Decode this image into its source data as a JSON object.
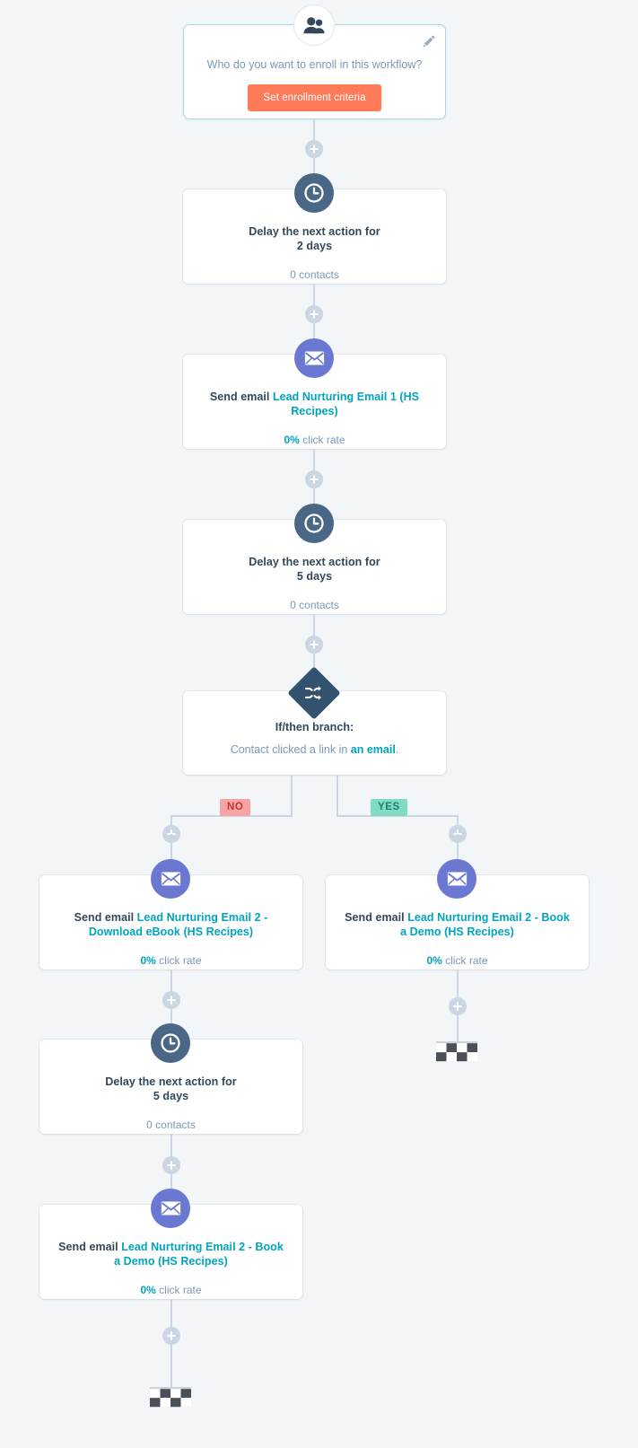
{
  "colors": {
    "background": "#f2f6f9",
    "card": "#ffffff",
    "connector": "#cbd6e2",
    "title_text": "#33475b",
    "muted_text": "#7c98b6",
    "link": "#00a4bd",
    "cta_button": "#ff7a59",
    "delay_icon": "#4a6785",
    "email_icon": "#6a78d1",
    "branch_icon": "#33526e",
    "badge_no_bg": "#f8a3a4",
    "badge_no_text": "#c0373a",
    "badge_yes_bg": "#7fdbc4",
    "badge_yes_text": "#1b8273",
    "enroll_border": "#a8d7e0"
  },
  "enrollment": {
    "icon": "contacts-icon",
    "question": "Who do you want to enroll in this workflow?",
    "button_label": "Set enrollment criteria",
    "edit_icon": "pencil-icon"
  },
  "nodes": [
    {
      "id": "delay-1",
      "icon": "clock-icon",
      "title_prefix": "Delay the next action for",
      "title_value": "2 days",
      "sub_value": "0 contacts"
    },
    {
      "id": "email-1",
      "icon": "envelope-icon",
      "title_prefix": "Send email ",
      "title_link": "Lead Nurturing Email 1 (HS Recipes)",
      "sub_pct": "0%",
      "sub_label": " click rate"
    },
    {
      "id": "delay-2",
      "icon": "clock-icon",
      "title_prefix": "Delay the next action for",
      "title_value": "5 days",
      "sub_value": "0 contacts"
    },
    {
      "id": "branch-1",
      "icon": "shuffle-icon",
      "title": "If/then branch:",
      "condition_prefix": "Contact clicked a link in ",
      "condition_link": "an email",
      "condition_suffix": "."
    },
    {
      "id": "email-no",
      "icon": "envelope-icon",
      "title_prefix": "Send email ",
      "title_link": "Lead Nurturing Email 2 - Download eBook (HS Recipes)",
      "sub_pct": "0%",
      "sub_label": " click rate"
    },
    {
      "id": "email-yes",
      "icon": "envelope-icon",
      "title_prefix": "Send email ",
      "title_link": "Lead Nurturing Email 2 - Book a Demo (HS Recipes)",
      "sub_pct": "0%",
      "sub_label": " click rate"
    },
    {
      "id": "delay-3",
      "icon": "clock-icon",
      "title_prefix": "Delay the next action for",
      "title_value": "5 days",
      "sub_value": "0 contacts"
    },
    {
      "id": "email-final",
      "icon": "envelope-icon",
      "title_prefix": "Send email ",
      "title_link": "Lead Nurturing Email 2 - Book a Demo (HS Recipes)",
      "sub_pct": "0%",
      "sub_label": " click rate"
    }
  ],
  "branch_labels": {
    "no": "NO",
    "yes": "YES"
  },
  "end_markers": [
    {
      "id": "end-yes",
      "icon": "checkered-flag-icon"
    },
    {
      "id": "end-no",
      "icon": "checkered-flag-icon"
    }
  ],
  "connectors": {
    "add_icon": "plus-icon",
    "count": 8
  }
}
